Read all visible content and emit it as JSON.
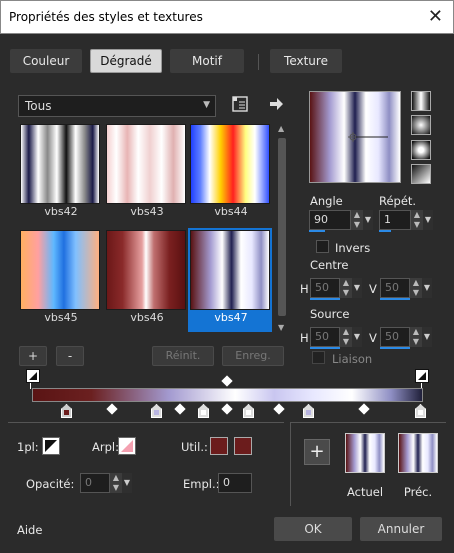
{
  "window": {
    "title": "Propriétés des styles et textures",
    "close": "✕"
  },
  "tabs": [
    "Couleur",
    "Dégradé",
    "Motif",
    "Texture"
  ],
  "filter": {
    "value": "Tous"
  },
  "gradients": [
    {
      "name": "vbs42",
      "bg": "linear-gradient(to right,#fff 0%,#1a1a48 10%,#fff 22%,#888 34%,#fff 46%,#111 58%,#fff 70%,#888 82%,#1a1a48 92%,#fff 100%)"
    },
    {
      "name": "vbs43",
      "bg": "linear-gradient(to right,#f5d0d0 0%,#fff 12%,#e8b4b4 26%,#fff 40%,#f0d0d0 55%,#fff 70%,#e0b0b0 85%,#fff 100%)"
    },
    {
      "name": "vbs44",
      "bg": "linear-gradient(to right,#2040ff 0%,#6080ff 12%,#ffffff 24%,#ffd000 38%,#ff2020 54%,#ffff80 70%,#ffffff 82%,#3050ff 100%)"
    },
    {
      "name": "vbs45",
      "bg": "linear-gradient(to right,#ffb060 0%,#ffa0a0 22%,#5fb8ff 42%,#2070e0 55%,#80c0ff 70%,#ffb080 100%)"
    },
    {
      "name": "vbs46",
      "bg": "linear-gradient(to right,#6b1818 0%,#8a2a2a 20%,#e6a0a0 45%,#ffffff 50%,#c07070 60%,#7a2020 80%,#5a1010 100%)"
    },
    {
      "name": "vbs47",
      "bg": "linear-gradient(to right,#5a1414 0%,#a39ad0 25%,#ffffff 40%,#202050 52%,#ffffff 64%,#e8e8ff 78%,#8f8fc4 90%,#fff 100%)"
    }
  ],
  "buttons": {
    "add": "+",
    "remove": "-",
    "reset": "Réinit.",
    "save": "Enreg."
  },
  "angle": {
    "label": "Angle",
    "value": "90",
    "fill": 0.25
  },
  "repeats": {
    "label": "Répét.",
    "value": "1"
  },
  "invert": {
    "label": "Invers"
  },
  "center": {
    "label": "Centre",
    "h_label": "H",
    "h_value": "50",
    "v_label": "V",
    "v_value": "50"
  },
  "source": {
    "label": "Source",
    "h_label": "H",
    "h_value": "50",
    "v_label": "V",
    "v_value": "50"
  },
  "link": {
    "label": "Liaison"
  },
  "fgbg": {
    "fg_label": "1pl:",
    "bg_label": "Arpl:",
    "user_label": "Util.:"
  },
  "opacity": {
    "label": "Opacité:",
    "value": "0"
  },
  "location": {
    "label": "Empl.:",
    "value": "0"
  },
  "previews": {
    "current": "Actuel",
    "previous": "Préc."
  },
  "footer": {
    "help": "Aide",
    "ok": "OK",
    "cancel": "Annuler"
  },
  "colors": {
    "accent": "#1474d4",
    "burgundy": "#6b1c1c"
  }
}
